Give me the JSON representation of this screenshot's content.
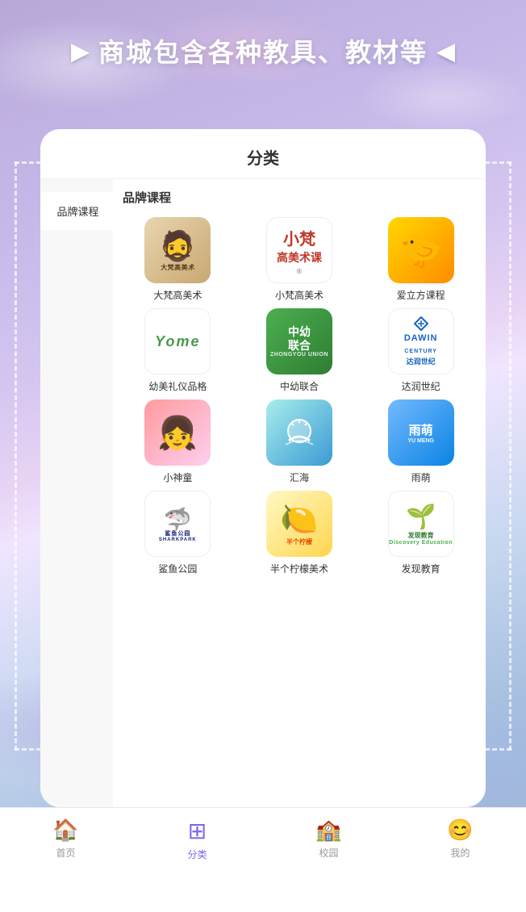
{
  "background": {
    "gradient_start": "#b8a8d8",
    "gradient_end": "#9ab0d0"
  },
  "header": {
    "title": "商城包含各种教具、教材等",
    "arrow_left": "▶",
    "arrow_right": "◀"
  },
  "card": {
    "title": "分类",
    "sidebar": {
      "items": [
        {
          "label": "品牌课程",
          "active": true
        }
      ]
    },
    "section_title": "品牌课程",
    "brands": [
      {
        "id": "dafan",
        "name": "大梵高美术",
        "logo_type": "dafan"
      },
      {
        "id": "xiaofan",
        "name": "小梵高美术",
        "logo_type": "xiaofan"
      },
      {
        "id": "ailifang",
        "name": "爱立方课程",
        "logo_type": "ailifang"
      },
      {
        "id": "youmei",
        "name": "幼美礼仪品格",
        "logo_type": "youmei"
      },
      {
        "id": "zhongyou",
        "name": "中幼联合",
        "logo_type": "zhongyou"
      },
      {
        "id": "darun",
        "name": "达润世纪",
        "logo_type": "darun"
      },
      {
        "id": "xiaoshentong",
        "name": "小神童",
        "logo_type": "xiaoshentong"
      },
      {
        "id": "huihai",
        "name": "汇海",
        "logo_type": "huihai"
      },
      {
        "id": "yumeng",
        "name": "雨萌",
        "logo_type": "yumeng"
      },
      {
        "id": "sharkpark",
        "name": "鲨鱼公园",
        "logo_type": "sharkpark"
      },
      {
        "id": "banlemon",
        "name": "半个柠檬美术",
        "logo_type": "banlemon"
      },
      {
        "id": "discovery",
        "name": "发现教育",
        "logo_type": "discovery"
      }
    ]
  },
  "bottom_nav": {
    "items": [
      {
        "id": "home",
        "label": "首页",
        "icon": "🏠",
        "active": false
      },
      {
        "id": "category",
        "label": "分类",
        "icon": "⊞",
        "active": true
      },
      {
        "id": "campus",
        "label": "校园",
        "icon": "🏫",
        "active": false
      },
      {
        "id": "mine",
        "label": "我的",
        "icon": "😊",
        "active": false
      }
    ]
  }
}
